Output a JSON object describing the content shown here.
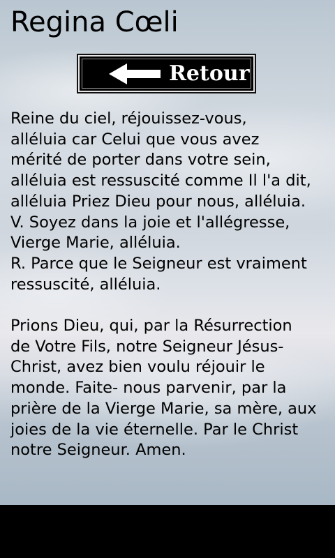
{
  "page": {
    "title": "Regina Cœli"
  },
  "back_button": {
    "label": "Retour",
    "icon": "arrow-left-icon"
  },
  "prayer": {
    "text": "Reine du ciel, réjouissez-vous,\nalléluia car Celui que vous avez\nmérité de porter dans votre sein,\nalléluia est ressuscité comme Il l'a dit,\nalléluia Priez Dieu pour nous, alléluia.\n V. Soyez dans la joie et l'allégresse,\nVierge Marie, alléluia.\n R. Parce que le Seigneur est vraiment\nressuscité, alléluia.\n\n Prions Dieu, qui, par la Résurrection\nde Votre Fils, notre Seigneur Jésus-\nChrist, avez bien voulu réjouir le\nmonde. Faite- nous parvenir, par la\nprière de la Vierge Marie, sa mère, aux\njoies de la vie éternelle. Par le Christ\nnotre Seigneur. Amen."
  },
  "colors": {
    "text": "#000000",
    "button_background": "#000000",
    "button_text": "#ffffff",
    "system_bar": "#000000"
  }
}
